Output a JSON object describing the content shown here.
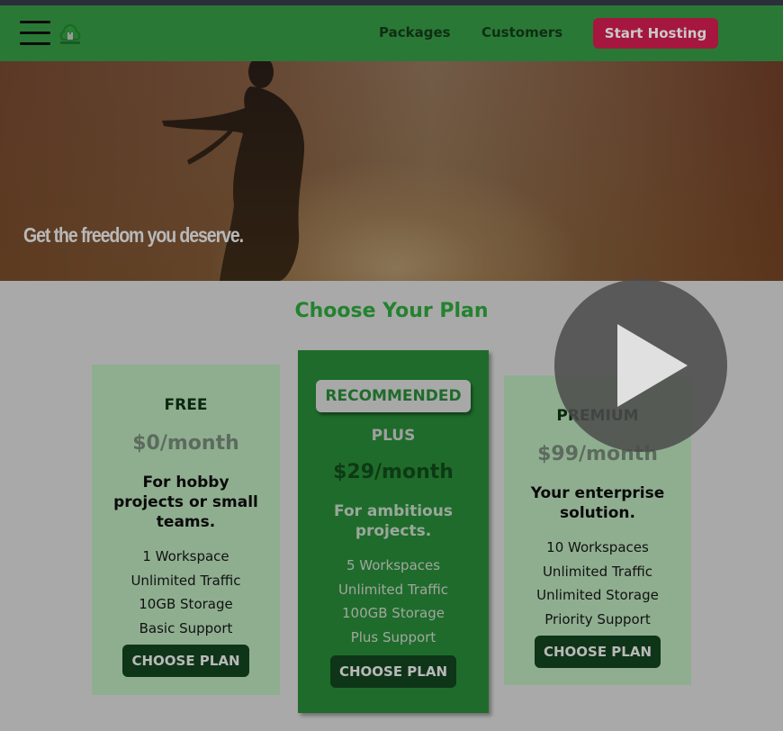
{
  "header": {
    "nav": [
      "Packages",
      "Customers"
    ],
    "cta": "Start Hosting"
  },
  "hero": {
    "tagline": "Get the freedom you deserve."
  },
  "plans": {
    "title": "Choose Your Plan",
    "badge": "RECOMMENDED",
    "items": [
      {
        "name": "FREE",
        "price": "$0/month",
        "desc": "For hobby projects or small teams.",
        "features": [
          "1 Workspace",
          "Unlimited Traffic",
          "10GB Storage",
          "Basic Support"
        ],
        "button": "CHOOSE PLAN"
      },
      {
        "name": "PLUS",
        "price": "$29/month",
        "desc": "For ambitious projects.",
        "features": [
          "5 Workspaces",
          "Unlimited Traffic",
          "100GB Storage",
          "Plus Support"
        ],
        "button": "CHOOSE PLAN"
      },
      {
        "name": "PREMIUM",
        "price": "$99/month",
        "desc": "Your enterprise solution.",
        "features": [
          "10 Workspaces",
          "Unlimited Traffic",
          "Unlimited Storage",
          "Priority Support"
        ],
        "button": "CHOOSE PLAN"
      }
    ]
  },
  "colors": {
    "header": "#2a7836",
    "cta": "#a5173f",
    "title": "#23822f"
  },
  "overlay": {
    "icon": "play-icon"
  }
}
